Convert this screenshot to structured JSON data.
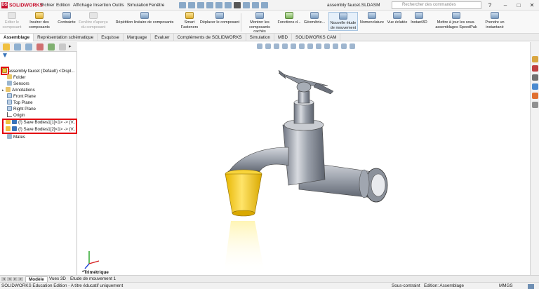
{
  "app": {
    "logo_text": "SOLIDWORKS",
    "document_title": "assembly faucet.SLDASM",
    "search_placeholder": "Rechercher des commandes"
  },
  "menu": [
    "Fichier",
    "Edition",
    "Affichage",
    "Insertion",
    "Outils",
    "Simulation",
    "Fenêtre"
  ],
  "ribbon": {
    "edit_component": "Editer le composant",
    "insert_components": "Insérer des composants",
    "mate": "Contrainte",
    "component_preview": "Fenêtre d'aperçu du composant",
    "linear_pattern": "Répétition linéaire de composants",
    "smart_fasteners": "Smart Fasteners",
    "move_component": "Déplacer le composant",
    "show_hidden": "Montrer les composants cachés",
    "assembly_features": "Fonctions d...",
    "reference_geometry": "Géométrie...",
    "new_motion_study": "Nouvelle étude de mouvement",
    "bom": "Nomenclature",
    "exploded_view": "Vue éclatée",
    "instant3d": "Instant3D",
    "update_speedpak": "Mettre à jour les sous-assemblages SpeedPak",
    "take_snapshot": "Prendre un instantané"
  },
  "tabs": [
    "Assemblage",
    "Représentation schématique",
    "Esquisse",
    "Marquage",
    "Evaluer",
    "Compléments de SOLIDWORKS",
    "Simulation",
    "MBD",
    "SOLIDWORKS CAM"
  ],
  "active_tab": "Assemblage",
  "tree": {
    "root": "assembly faucet (Default) <Displ...",
    "items": [
      {
        "label": "Folder",
        "icon": "folder-icon"
      },
      {
        "label": "Sensors",
        "icon": "sensors-icon"
      },
      {
        "label": "Annotations",
        "icon": "annotations-icon"
      },
      {
        "label": "Front Plane",
        "icon": "plane-icon"
      },
      {
        "label": "Top Plane",
        "icon": "plane-icon"
      },
      {
        "label": "Right Plane",
        "icon": "plane-icon"
      },
      {
        "label": "Origin",
        "icon": "origin-icon"
      },
      {
        "label": "(f) Save Bodies1[1]<1> -> (V...",
        "icon": "part-icon"
      },
      {
        "label": "(f) Save Bodies1[2]<1> -> (V...",
        "icon": "part-icon"
      },
      {
        "label": "Mates",
        "icon": "mates-icon"
      }
    ]
  },
  "viewport": {
    "view_label": "*Trimétrique"
  },
  "bottom_tabs": [
    "Modèle",
    "Vues 3D",
    "Etude de mouvement 1"
  ],
  "active_bottom_tab": "Modèle",
  "status": {
    "edition": "SOLIDWORKS Education Edition - A titre éducatif uniquement",
    "constraint": "Sous-contraint",
    "editing": "Edition: Assemblage",
    "units": "MMGS"
  },
  "colors": {
    "accent_red": "#c8102e",
    "highlight_red": "#e3000f",
    "body_gray": "#8a8f99",
    "cone_yellow": "#f2c40f"
  }
}
